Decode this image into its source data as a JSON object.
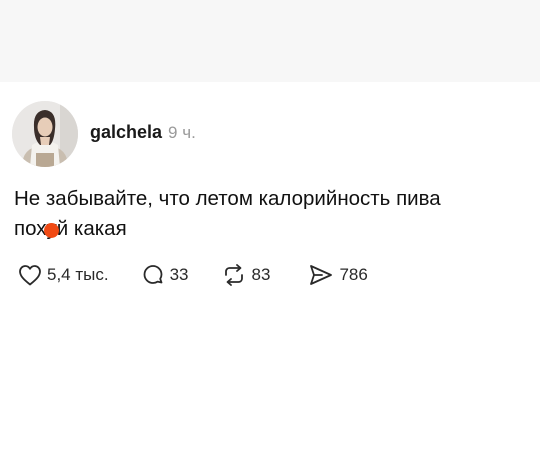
{
  "post": {
    "author": "galchela",
    "time": "9 ч.",
    "text_part1": "Не забывайте, что летом калорийность пива",
    "text_part2_before": "пох",
    "text_part2_censored": "у",
    "text_part2_after": "й какая",
    "stats": {
      "likes": "5,4 тыс.",
      "comments": "33",
      "reposts": "83",
      "shares": "786"
    }
  },
  "icons": {
    "like": "heart-icon",
    "comment": "comment-bubble-icon",
    "repost": "repost-icon",
    "share": "send-icon"
  },
  "colors": {
    "censor_dot": "#f04a14",
    "muted_text": "#9a9a9a",
    "top_band": "#f7f7f7"
  }
}
